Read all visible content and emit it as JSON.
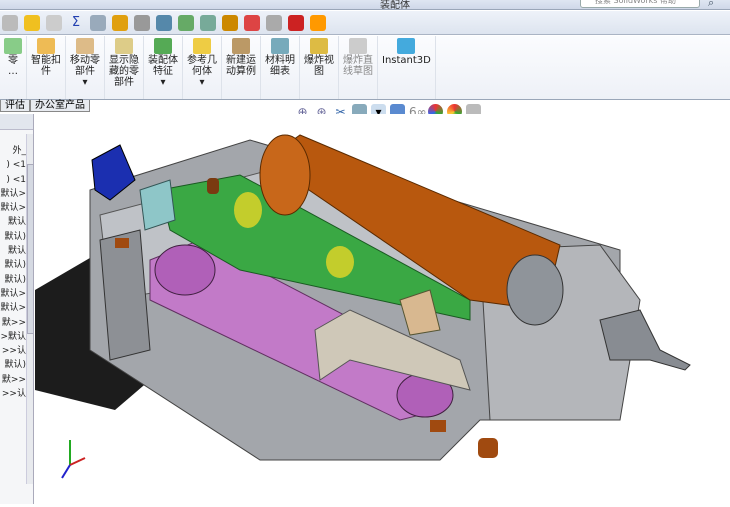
{
  "window": {
    "title": "装配体",
    "search_placeholder": "搜索 SolidWorks 帮助"
  },
  "toolbar_icons": [
    "insert-components-icon",
    "mate-check-icon",
    "check-icon",
    "sum-icon",
    "smart-fasteners-icon",
    "warning-icon",
    "distribute-icon",
    "question-doc-icon",
    "interference-icon",
    "table-icon",
    "render-icon",
    "radiation-icon",
    "check-circle-icon",
    "color-swatch-icon",
    "appearance-icon"
  ],
  "ribbon": [
    {
      "label": "零\n…",
      "icon": "insert-part-icon"
    },
    {
      "label": "智能扣\n件",
      "icon": "smart-fastener-icon"
    },
    {
      "label": "移动零\n部件\n▾",
      "icon": "move-component-icon"
    },
    {
      "label": "显示隐\n藏的零\n部件",
      "icon": "show-hidden-icon"
    },
    {
      "label": "装配体\n特征\n▾",
      "icon": "assembly-feature-icon"
    },
    {
      "label": "参考几\n何体\n▾",
      "icon": "reference-geometry-icon"
    },
    {
      "label": "新建运\n动算例",
      "icon": "motion-study-icon"
    },
    {
      "label": "材料明\n细表",
      "icon": "bom-icon"
    },
    {
      "label": "爆炸视\n图",
      "icon": "exploded-view-icon"
    },
    {
      "label": "爆炸直\n线草图",
      "icon": "explode-line-icon",
      "disabled": true
    },
    {
      "label": "Instant3D",
      "icon": "instant3d-icon"
    }
  ],
  "tabs": [
    "评估",
    "办公室产品"
  ],
  "tree": [
    "_外",
    "",
    "",
    "",
    "",
    "",
    "",
    "",
    "1> (",
    "1> (",
    "<默认",
    "<默认",
    "默认",
    "(默认",
    "默认",
    "(默认",
    "(默认",
    "<默认",
    "<默认",
    "<<默",
    "默认<",
    "认<<",
    "(默认",
    "<<默",
    "认<<"
  ],
  "colors": {
    "body": "#8f939a",
    "motor": "#b8580e",
    "belt": "#c070c0",
    "green": "#2fa83a",
    "blue": "#1b2fb0",
    "yellow": "#d8d020"
  }
}
